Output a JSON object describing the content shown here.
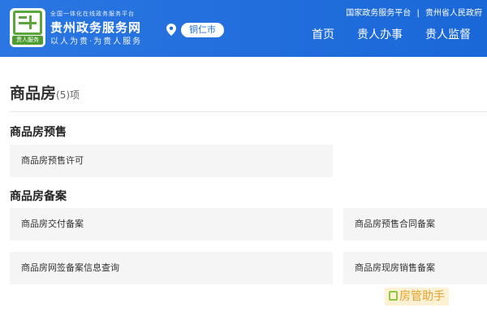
{
  "header": {
    "logo_tag": "贵人服务",
    "site_sub": "全国一体化在线政务服务平台",
    "site_title": "贵州政务服务网",
    "slogan": "以人为贵·为贵人服务",
    "city": "铜仁市",
    "top_links": [
      "国家政务服务平台",
      "贵州省人民政府"
    ],
    "top_separator": "|",
    "nav": [
      "首页",
      "贵人办事",
      "贵人监督"
    ],
    "colors": {
      "brand_blue": "#1f6fdc",
      "logo_green": "#5aa63a"
    }
  },
  "page": {
    "title": "商品房",
    "count": "(5)项"
  },
  "sections": [
    {
      "heading": "商品房预售",
      "items": [
        "商品房预售许可"
      ]
    },
    {
      "heading": "商品房备案",
      "items": [
        "商品房交付备案",
        "商品房预售合同备案",
        "商品房网签备案信息查询",
        "商品房现房销售备案"
      ]
    }
  ],
  "watermark": {
    "text": "房管助手"
  },
  "icons": {
    "location": "location-pin-icon"
  }
}
